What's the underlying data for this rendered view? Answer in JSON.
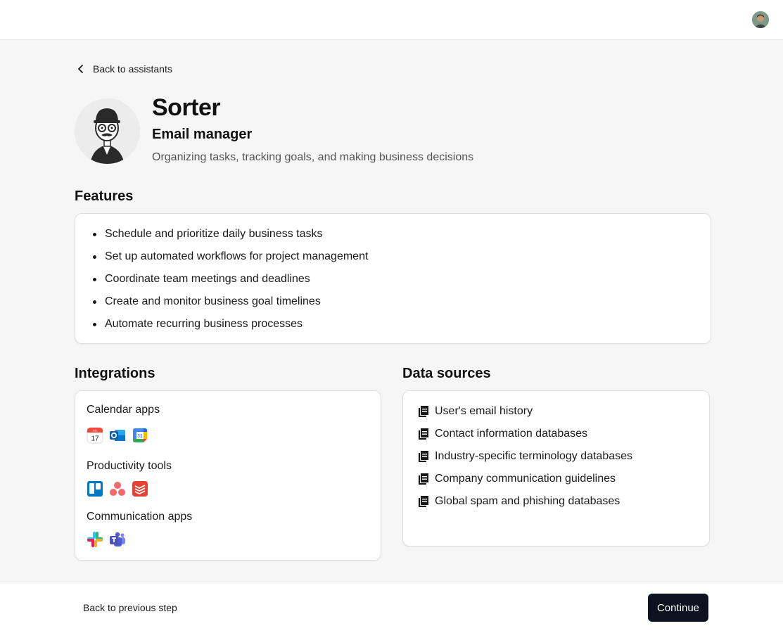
{
  "nav": {
    "back_label": "Back to assistants"
  },
  "assistant": {
    "name": "Sorter",
    "role": "Email manager",
    "description": "Organizing tasks, tracking goals, and making business decisions"
  },
  "features": {
    "title": "Features",
    "items": [
      "Schedule and prioritize daily business tasks",
      "Set up automated workflows for project management",
      "Coordinate team meetings and deadlines",
      "Create and monitor business goal timelines",
      "Automate recurring business processes"
    ]
  },
  "integrations": {
    "title": "Integrations",
    "groups": [
      {
        "label": "Calendar apps",
        "icons": [
          "apple-calendar-icon",
          "outlook-icon",
          "google-calendar-icon"
        ]
      },
      {
        "label": "Productivity tools",
        "icons": [
          "trello-icon",
          "asana-icon",
          "todoist-icon"
        ]
      },
      {
        "label": "Communication apps",
        "icons": [
          "slack-icon",
          "microsoft-teams-icon"
        ]
      }
    ]
  },
  "data_sources": {
    "title": "Data sources",
    "items": [
      "User's email history",
      "Contact information databases",
      "Industry-specific terminology databases",
      "Company communication guidelines",
      "Global spam and phishing databases"
    ]
  },
  "footer": {
    "back_label": "Back to previous step",
    "continue_label": "Continue"
  },
  "colors": {
    "primary_button": "#0d1220",
    "page_background": "#f6f6f6",
    "card_background": "#ffffff"
  }
}
